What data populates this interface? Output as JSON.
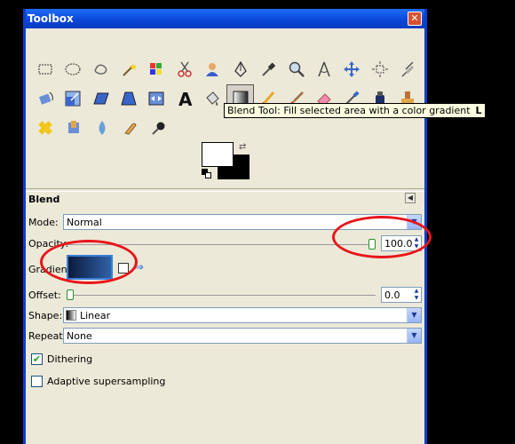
{
  "window": {
    "title": "Toolbox",
    "close": "✕"
  },
  "tools": {
    "row1": [
      "rect-select",
      "ellipse-select",
      "free-select",
      "fuzzy-select",
      "color-select",
      "scissors",
      "foreground-select",
      "paths",
      "color-picker",
      "zoom",
      "measure",
      "move",
      "align",
      "crop"
    ],
    "row2": [
      "rotate",
      "scale",
      "shear",
      "perspective",
      "flip",
      "text",
      "bucket-fill",
      "blend",
      "pencil",
      "paintbrush",
      "eraser",
      "airbrush",
      "ink",
      "clone"
    ],
    "row3": [
      "heal",
      "perspective-clone",
      "blur",
      "smudge",
      "dodge-burn"
    ]
  },
  "tooltip": {
    "text": "Blend Tool: Fill selected area with a color gradient",
    "shortcut": "L"
  },
  "colors": {
    "foreground": "#ffffff",
    "background": "#000000",
    "accent_blue": "#0a45d8",
    "highlight_red": "#e8151b"
  },
  "panel": {
    "title": "Blend",
    "mode": {
      "label": "Mode:",
      "value": "Normal"
    },
    "opacity": {
      "label": "Opacity:",
      "value": "100.0",
      "level": 1.0
    },
    "gradient": {
      "label": "Gradient:"
    },
    "offset": {
      "label": "Offset:",
      "value": "0.0",
      "level": 0.0
    },
    "shape": {
      "label": "Shape:",
      "value": "Linear"
    },
    "repeat": {
      "label": "Repeat:",
      "value": "None"
    },
    "dithering": {
      "label": "Dithering",
      "checked": true
    },
    "supersampling": {
      "label": "Adaptive supersampling",
      "checked": false
    }
  }
}
